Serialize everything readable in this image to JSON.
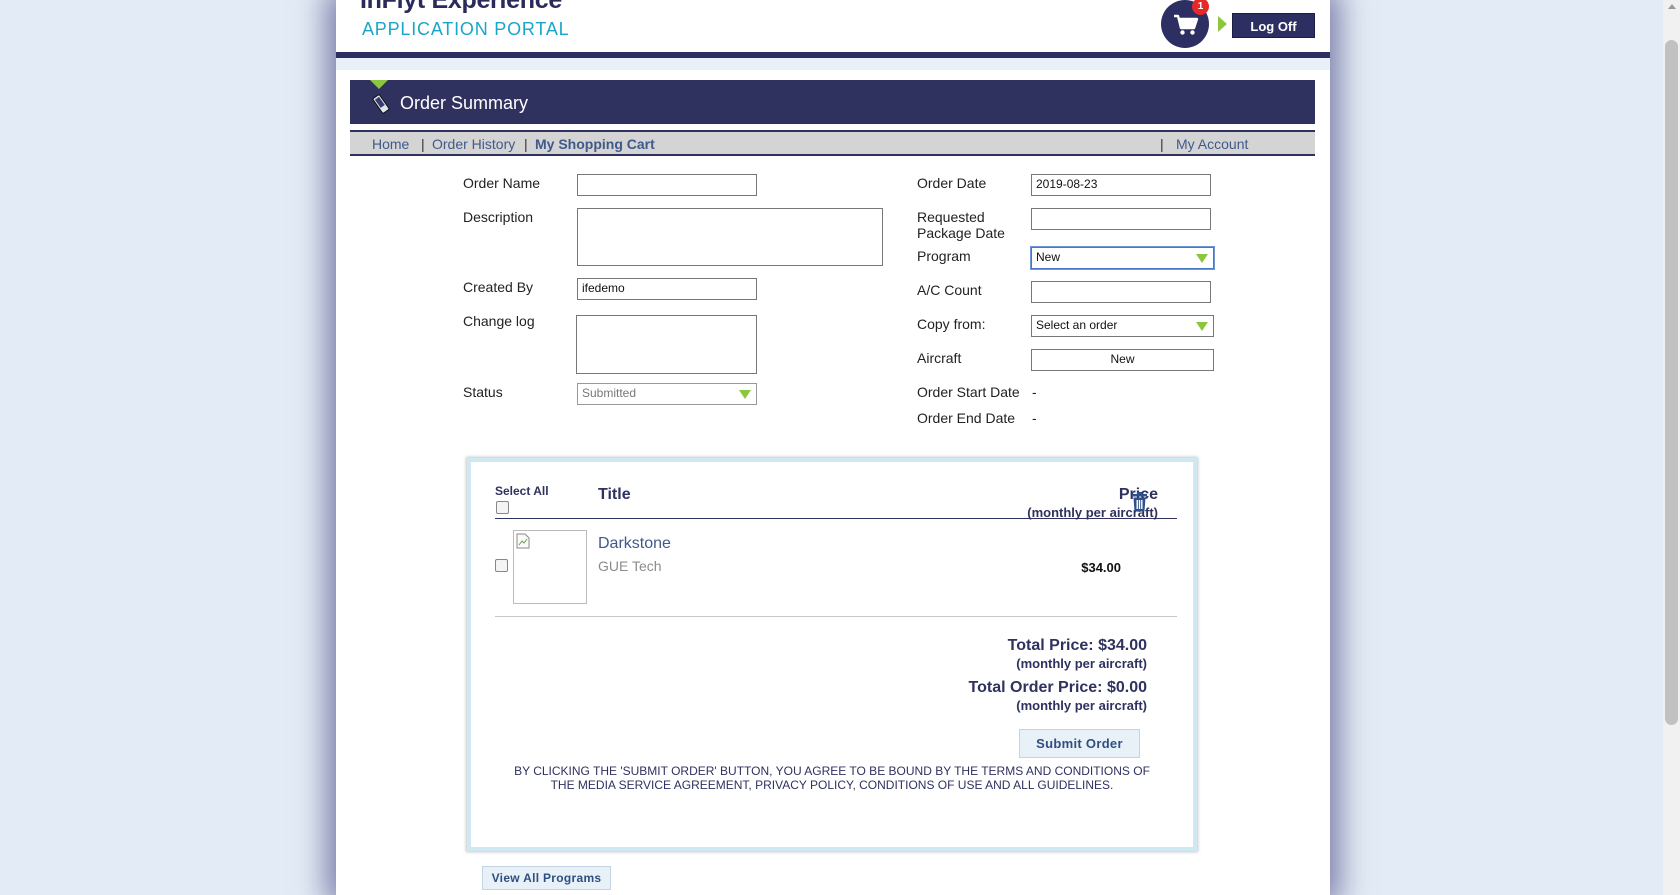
{
  "header": {
    "logo_title": "InFlyt Experience",
    "logo_subtitle": "APPLICATION PORTAL",
    "cart_count": "1",
    "logoff_label": "Log Off"
  },
  "summary": {
    "title": "Order Summary"
  },
  "nav": {
    "home": "Home",
    "order_history": "Order History",
    "shopping_cart": "My Shopping Cart",
    "my_account": "My Account",
    "separator": "|"
  },
  "form": {
    "order_name": {
      "label": "Order Name",
      "value": ""
    },
    "description": {
      "label": "Description",
      "value": ""
    },
    "created_by": {
      "label": "Created By",
      "value": "ifedemo"
    },
    "change_log": {
      "label": "Change log",
      "value": ""
    },
    "status": {
      "label": "Status",
      "value": "Submitted"
    },
    "order_date": {
      "label": "Order Date",
      "value": "2019-08-23"
    },
    "requested_date": {
      "label_line1": "Requested",
      "label_line2": "Package Date",
      "value": ""
    },
    "program": {
      "label": "Program",
      "value": "New"
    },
    "ac_count": {
      "label": "A/C Count",
      "value": ""
    },
    "copy_from": {
      "label": "Copy from:",
      "value": "Select an order"
    },
    "aircraft": {
      "label": "Aircraft",
      "value": "New"
    },
    "order_start": {
      "label": "Order Start Date",
      "value": "-"
    },
    "order_end": {
      "label": "Order End Date",
      "value": "-"
    }
  },
  "cart": {
    "select_all": "Select All",
    "title_header": "Title",
    "price_header": "Price",
    "price_sub": "(monthly per aircraft)",
    "items": [
      {
        "title": "Darkstone",
        "vendor": "GUE Tech",
        "price": "$34.00"
      }
    ],
    "total_price": "Total Price: $34.00",
    "total_price_sub": "(monthly per aircraft)",
    "total_order_price": "Total Order Price: $0.00",
    "total_order_sub": "(monthly per aircraft)",
    "submit_label": "Submit Order",
    "terms_line1": "BY CLICKING THE 'SUBMIT ORDER' BUTTON, YOU AGREE TO BE BOUND BY THE TERMS AND CONDITIONS OF",
    "terms_line2": "THE MEDIA SERVICE AGREEMENT, PRIVACY POLICY, CONDITIONS OF USE AND ALL GUIDELINES."
  },
  "footer": {
    "view_all_label": "View All Programs"
  },
  "colors": {
    "navy": "#2f315f",
    "accent_green": "#8cc63f",
    "link_blue": "#3f5a8a",
    "badge_red": "#e62828",
    "logo_cyan": "#1aa6c8"
  }
}
